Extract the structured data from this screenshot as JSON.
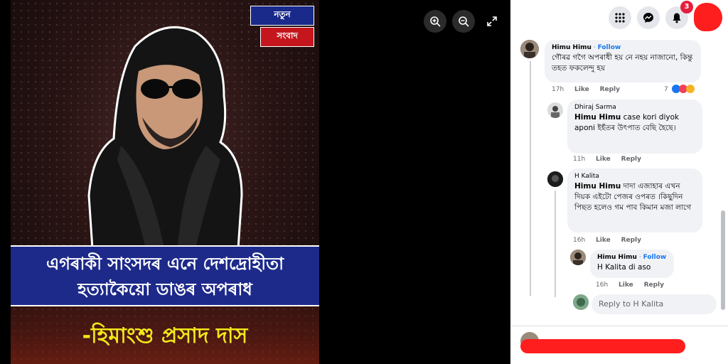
{
  "poster": {
    "logo_top": "নতুন",
    "logo_bottom": "সংবাদ",
    "headline_line1": "এগৰাকী সাংসদৰ এনে দেশদ্ৰোহীতা",
    "headline_line2": "হত্যাকৈয়ো ডাঙৰ অপৰাধ",
    "author": "-হিমাংশু প্ৰসাদ দাস"
  },
  "viewer_controls": [
    "zoom-in-icon",
    "zoom-out-icon",
    "fullscreen-icon"
  ],
  "topbar": {
    "icons": [
      "menu-grid-icon",
      "messenger-icon",
      "notifications-icon"
    ],
    "notification_count": "3"
  },
  "comments": [
    {
      "author": "Himu Himu",
      "follow": "Follow",
      "text": "গৌৰৱ গগৈ অপৰাধী হয় নে নহয় নাজানো, কিন্তু তহত ফকলেন্দু হয়",
      "time": "17h",
      "like": "Like",
      "reply": "Reply",
      "reaction_count": "7"
    },
    {
      "author": "Dhiraj Sarma",
      "mention": "Himu Himu",
      "text": "case kori diyok aponi ইহঁতৰ উৎপাত বেছি হৈছে।",
      "time": "11h",
      "like": "Like",
      "reply": "Reply"
    },
    {
      "author": "H Kalita",
      "mention": "Himu Himu",
      "text": "দাদা এজাহাৰ এখন দিয়ক এইটো পেজৰ ওপৰত ।কিছুদিন পিছত হলেও গম পাব কিমান মজা লাগে",
      "time": "16h",
      "like": "Like",
      "reply": "Reply"
    },
    {
      "author": "Himu Himu",
      "follow": "Follow",
      "mention": "H Kalita",
      "text": "di aso",
      "time": "16h",
      "like": "Like",
      "reply": "Reply"
    }
  ],
  "reply_input": {
    "placeholder": "Reply to H Kalita"
  },
  "colors": {
    "accent": "#1877f2",
    "banner": "#1d2a8a",
    "author_text": "#f2e81a",
    "badge": "#e41e3f"
  }
}
